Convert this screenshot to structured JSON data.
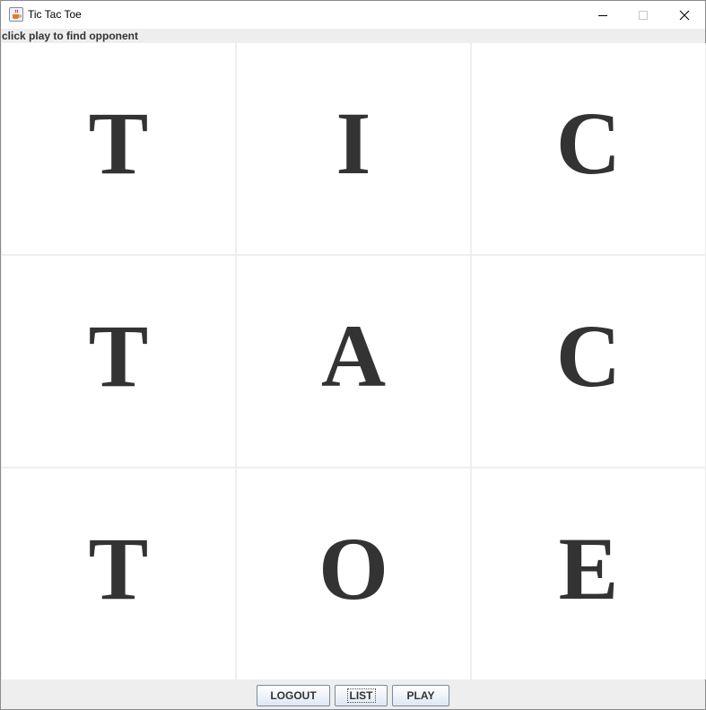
{
  "window": {
    "title": "Tic Tac Toe"
  },
  "status": {
    "text": "click play to find opponent"
  },
  "board": {
    "cells": [
      "T",
      "I",
      "C",
      "T",
      "A",
      "C",
      "T",
      "O",
      "E"
    ]
  },
  "buttons": {
    "logout": "LOGOUT",
    "list": "LIST",
    "play": "PLAY"
  },
  "icons": {
    "app": "java-coffee-icon",
    "minimize": "minimize-icon",
    "maximize": "maximize-icon",
    "close": "close-icon"
  },
  "colors": {
    "piece": "#333333",
    "panel": "#eeeeee",
    "cell": "#ffffff"
  }
}
